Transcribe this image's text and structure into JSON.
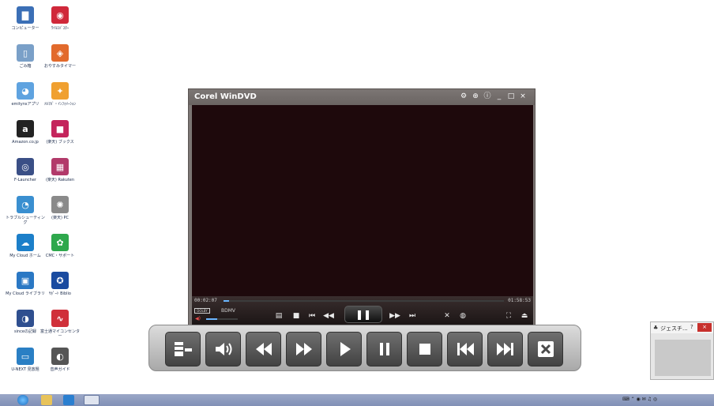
{
  "desktop": {
    "icons": [
      {
        "label": "コンピューター",
        "color": "#3b6fb6",
        "glyph": "▇"
      },
      {
        "label": "ｳｲﾙｽﾊﾞｽﾀｰ",
        "color": "#d0283a",
        "glyph": "◉"
      },
      {
        "label": "ごみ箱",
        "color": "#7aa0c8",
        "glyph": "▯"
      },
      {
        "label": "おやすみタイマー",
        "color": "#e26a2c",
        "glyph": "◈"
      },
      {
        "label": "emitynsアプリ",
        "color": "#5fa3e0",
        "glyph": "◕"
      },
      {
        "label": "ﾒﾙﾏｶﾞ・ｲﾝﾌｫﾒｰｼｮﾝ",
        "color": "#f0a030",
        "glyph": "✦"
      },
      {
        "label": "Amazon.co.jp",
        "color": "#222222",
        "glyph": "a"
      },
      {
        "label": "(楽天) ブックス",
        "color": "#c4245c",
        "glyph": "■"
      },
      {
        "label": "F-Launcher",
        "color": "#3a4f86",
        "glyph": "◎"
      },
      {
        "label": "(楽天) Rakuten",
        "color": "#b23a6a",
        "glyph": "▦"
      },
      {
        "label": "トラブルシューティング",
        "color": "#3a8fd0",
        "glyph": "◔"
      },
      {
        "label": "(楽天) PC",
        "color": "#8a8a8a",
        "glyph": "✺"
      },
      {
        "label": "My Cloud ホーム",
        "color": "#1c7fc9",
        "glyph": "☁"
      },
      {
        "label": "CMC・サポート",
        "color": "#2ea84c",
        "glyph": "✿"
      },
      {
        "label": "My Cloud ライブラリ",
        "color": "#2a78c4",
        "glyph": "▣"
      },
      {
        "label": "ｻﾎﾟｰﾄ Biblio",
        "color": "#1a4ba0",
        "glyph": "✪"
      },
      {
        "label": "sinceの記録",
        "color": "#2f4f8f",
        "glyph": "◑"
      },
      {
        "label": "富士通マイコンセンター",
        "color": "#d0303a",
        "glyph": "∿"
      },
      {
        "label": "U-NEXT 見放題",
        "color": "#2a7fc4",
        "glyph": "▭"
      },
      {
        "label": "音声ガイド",
        "color": "#555555",
        "glyph": "◐"
      }
    ]
  },
  "player": {
    "title": "Corel WinDVD",
    "titlebar_buttons": [
      "⚙",
      "⊕",
      "ⓘ",
      "_",
      "□",
      "×"
    ],
    "current_time": "00:02:07",
    "total_time": "01:58:53",
    "format_label": "BDMV",
    "dolby_label": "DOLBY",
    "progress_fraction": 0.02,
    "volume_fraction": 0.35,
    "controls": [
      "▤",
      "■",
      "⏮",
      "◀◀",
      "❚❚",
      "▶▶",
      "⏭",
      "✕",
      "◍",
      "⛶",
      "⏏"
    ]
  },
  "big_toolbar": {
    "buttons": [
      {
        "name": "menu-toggle-icon"
      },
      {
        "name": "volume-icon"
      },
      {
        "name": "rewind-icon"
      },
      {
        "name": "fast-forward-icon"
      },
      {
        "name": "play-icon"
      },
      {
        "name": "pause-icon"
      },
      {
        "name": "stop-icon"
      },
      {
        "name": "previous-chapter-icon"
      },
      {
        "name": "next-chapter-icon"
      },
      {
        "name": "close-icon"
      }
    ]
  },
  "gesture_window": {
    "title": "ジェスチ...",
    "help": "?",
    "close": "×"
  },
  "taskbar": {
    "items": [
      "IE",
      "Explorer",
      "Mail",
      "WinDVD"
    ],
    "tray_text": "⌨ ⌃ ◉ ✉ ♫ ◎"
  }
}
